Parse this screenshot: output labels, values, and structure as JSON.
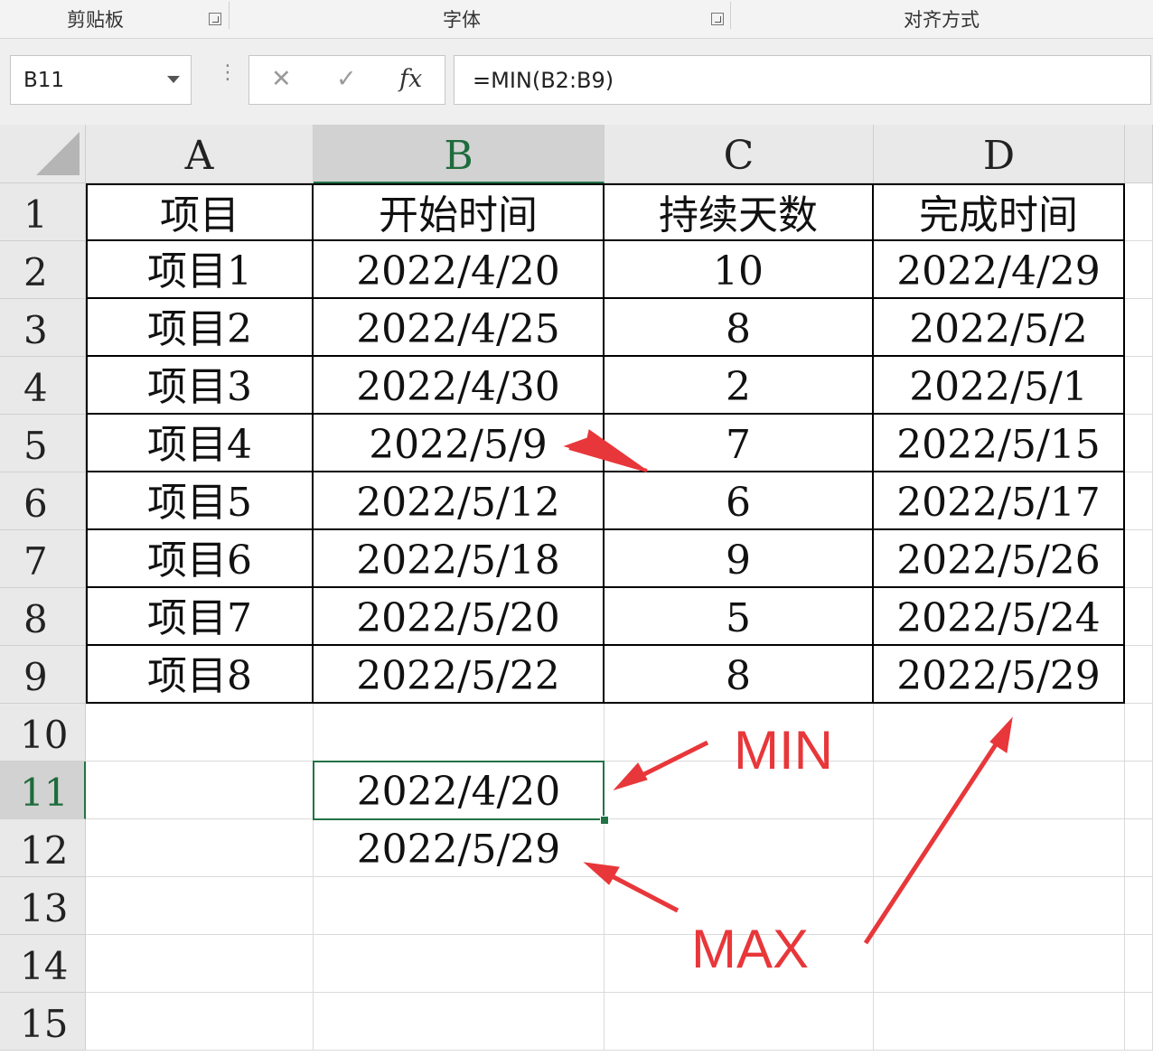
{
  "ribbon": {
    "groups": [
      {
        "label": "剪贴板"
      },
      {
        "label": "字体"
      },
      {
        "label": "对齐方式"
      }
    ]
  },
  "formula_bar": {
    "name_box": "B11",
    "cancel_icon": "✕",
    "enter_icon": "✓",
    "fx_icon": "fx",
    "formula": "=MIN(B2:B9)"
  },
  "columns": [
    "A",
    "B",
    "C",
    "D"
  ],
  "rows": [
    "1",
    "2",
    "3",
    "4",
    "5",
    "6",
    "7",
    "8",
    "9",
    "10",
    "11",
    "12",
    "13",
    "14",
    "15"
  ],
  "table": {
    "headers": [
      "项目",
      "开始时间",
      "持续天数",
      "完成时间"
    ],
    "rows": [
      [
        "项目1",
        "2022/4/20",
        "10",
        "2022/4/29"
      ],
      [
        "项目2",
        "2022/4/25",
        "8",
        "2022/5/2"
      ],
      [
        "项目3",
        "2022/4/30",
        "2",
        "2022/5/1"
      ],
      [
        "项目4",
        "2022/5/9",
        "7",
        "2022/5/15"
      ],
      [
        "项目5",
        "2022/5/12",
        "6",
        "2022/5/17"
      ],
      [
        "项目6",
        "2022/5/18",
        "9",
        "2022/5/26"
      ],
      [
        "项目7",
        "2022/5/20",
        "5",
        "2022/5/24"
      ],
      [
        "项目8",
        "2022/5/22",
        "8",
        "2022/5/29"
      ]
    ]
  },
  "results": {
    "min_value": "2022/4/20",
    "max_value": "2022/5/29"
  },
  "annotations": {
    "min_label": "MIN",
    "max_label": "MAX",
    "arrow_color": "#e8373a"
  },
  "selection": {
    "active_cell": "B11",
    "accent": "#217346"
  }
}
